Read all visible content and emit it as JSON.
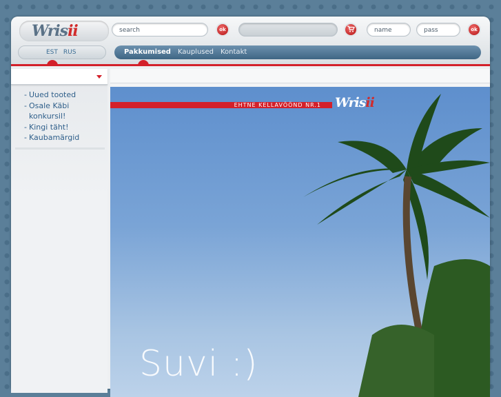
{
  "header": {
    "logo_main": "Wris",
    "logo_accent": "ii",
    "search_placeholder": "search",
    "search_ok": "ok",
    "name_placeholder": "name",
    "pass_placeholder": "pass",
    "login_ok": "ok",
    "cart_icon": "cart-icon"
  },
  "languages": [
    "EST",
    "RUS"
  ],
  "nav": [
    "Pakkumised",
    "Kauplused",
    "Kontakt"
  ],
  "sidebar": {
    "menu": [
      "Uued tooted",
      "Osale Käbi",
      "konkursil!",
      "Kingi täht!",
      "Kaubamärgid"
    ]
  },
  "banner": {
    "tagline": "EHTNE KELLAVÖÖND NR.1",
    "logo_main": "Wris",
    "logo_accent": "ii",
    "headline": "Suvi :)"
  },
  "colors": {
    "accent": "#d3202a",
    "nav": "#4f7594",
    "link": "#2f5f8a"
  }
}
